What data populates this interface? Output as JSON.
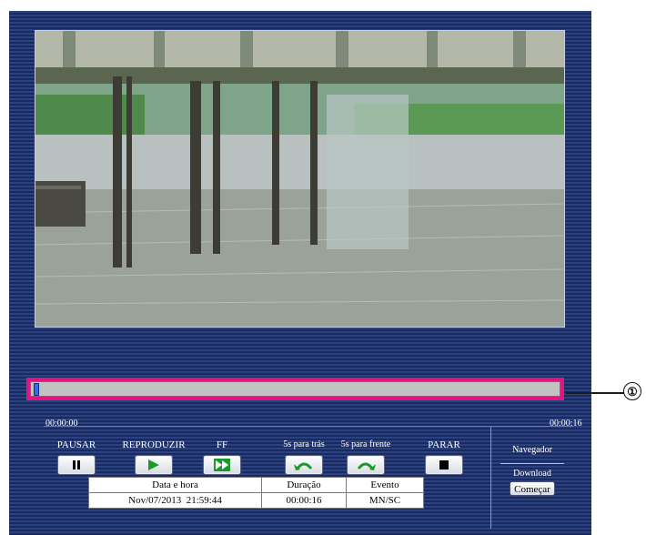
{
  "seekbar": {
    "position": 0.0,
    "start_time": "00:00:00",
    "end_time": "00:00:16"
  },
  "controls": {
    "pause": "PAUSAR",
    "play": "REPRODUZIR",
    "ff": "FF",
    "back5": "5s para trás",
    "fwd5": "5s para frente",
    "stop": "PARAR"
  },
  "navigator": {
    "title": "Navegador",
    "download_label": "Download",
    "start_button": "Começar"
  },
  "info_table": {
    "headers": [
      "Data e hora",
      "Duração",
      "Evento"
    ],
    "row": [
      "Nov/07/2013  21:59:44",
      "00:00:16",
      "MN/SC"
    ]
  },
  "callout": {
    "number": "①"
  },
  "colors": {
    "highlight": "#e0157f",
    "panel_bg": "#263a78",
    "play_green": "#1a9a2a"
  }
}
